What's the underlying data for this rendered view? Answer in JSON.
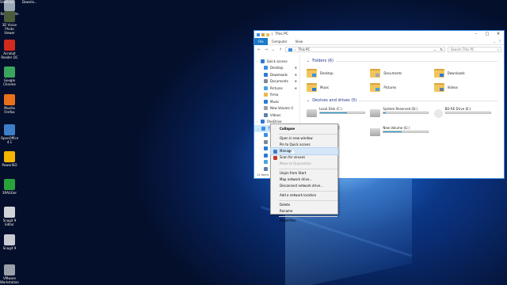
{
  "desktop": {
    "icons": [
      {
        "label": "Recycle Bin",
        "icon": "recycle-bin-icon",
        "color": "#9aa7b5"
      },
      {
        "label": "3D Vision Photo Viewer",
        "icon": "photo-viewer-icon",
        "color": "#4a5a3a"
      },
      {
        "label": "Acrobat Reader DC",
        "icon": "acrobat-icon",
        "color": "#d22a1e"
      },
      {
        "label": "Google Chrome",
        "icon": "chrome-icon",
        "color": "#3ba55d"
      },
      {
        "label": "Mozilla Firefox",
        "icon": "firefox-icon",
        "color": "#e8701a"
      },
      {
        "label": "OpenOffice 4.1",
        "icon": "openoffice-icon",
        "color": "#3d7ec7"
      },
      {
        "label": "PowerISO",
        "icon": "poweriso-icon",
        "color": "#f4b400"
      },
      {
        "label": "3RAGGer",
        "icon": "green-triangle-icon",
        "color": "#27a33a"
      },
      {
        "label": "Snagit 9 Editor",
        "icon": "snagit-editor-icon",
        "color": "#d0d4d8"
      },
      {
        "label": "Snagit 9",
        "icon": "snagit-icon",
        "color": "#c8ccd2"
      },
      {
        "label": "VMware Workstation",
        "icon": "vmware-icon",
        "color": "#9aa0a8"
      }
    ],
    "top_labels": [
      "Shortcut",
      "Downlo..."
    ]
  },
  "explorer": {
    "title": "This PC",
    "tabs": [
      "File",
      "Computer",
      "View"
    ],
    "address": "This PC",
    "search_placeholder": "Search This PC",
    "sidebar": [
      {
        "label": "Quick access",
        "icon": "star-icon",
        "color": "#2c7ad6",
        "level": 0
      },
      {
        "label": "Desktop",
        "icon": "desktop-icon",
        "color": "#3a8ee6",
        "level": 1,
        "pinned": true
      },
      {
        "label": "Downloads",
        "icon": "downloads-icon",
        "color": "#2c7ad6",
        "level": 1,
        "pinned": true
      },
      {
        "label": "Documents",
        "icon": "documents-icon",
        "color": "#7d8a99",
        "level": 1,
        "pinned": true
      },
      {
        "label": "Pictures",
        "icon": "pictures-icon",
        "color": "#4aa3df",
        "level": 1,
        "pinned": true
      },
      {
        "label": "firma",
        "icon": "folder-icon",
        "color": "#e8b84a",
        "level": 1
      },
      {
        "label": "Music",
        "icon": "music-icon",
        "color": "#2c7ad6",
        "level": 1
      },
      {
        "label": "New Volume (I",
        "icon": "drive-icon",
        "color": "#9aa0a8",
        "level": 1
      },
      {
        "label": "Videos",
        "icon": "videos-icon",
        "color": "#5d7fa8",
        "level": 1
      },
      {
        "label": "OneDrive",
        "icon": "onedrive-icon",
        "color": "#2c7ad6",
        "level": 0
      },
      {
        "label": "This PC",
        "icon": "pc-icon",
        "color": "#3a8ee6",
        "level": 0,
        "selected": true
      },
      {
        "label": "De",
        "icon": "desktop-icon",
        "color": "#3a8ee6",
        "level": 1
      },
      {
        "label": "Do",
        "icon": "documents-icon",
        "color": "#7d8a99",
        "level": 1
      },
      {
        "label": "Do",
        "icon": "downloads-icon",
        "color": "#2c7ad6",
        "level": 1
      },
      {
        "label": "M",
        "icon": "music-icon",
        "color": "#2c7ad6",
        "level": 1
      },
      {
        "label": "Pi",
        "icon": "pictures-icon",
        "color": "#4aa3df",
        "level": 1
      },
      {
        "label": "Vi",
        "icon": "videos-icon",
        "color": "#5d7fa8",
        "level": 1
      }
    ],
    "folders_header": "Folders (6)",
    "folders": [
      "Desktop",
      "Documents",
      "Downloads",
      "Music",
      "Pictures",
      "Videos"
    ],
    "drives_header": "Devices and drives (5)",
    "drives": [
      {
        "name": "Local Disk (C:)",
        "free": "",
        "fill": 0.6,
        "icon": "windows-drive-icon"
      },
      {
        "name": "System Reserved (D:)",
        "free": "",
        "fill": 0.05,
        "icon": "hdd-icon"
      },
      {
        "name": "BD-RE Drive (E:)",
        "free": "",
        "fill": 0,
        "icon": "bd-drive-icon"
      },
      {
        "name": "CD Drive (F:)",
        "free": "",
        "fill": 0,
        "icon": "cd-drive-icon"
      },
      {
        "name": "New Volume (G:)",
        "free": "",
        "fill": 0.4,
        "icon": "hdd-icon"
      }
    ],
    "status": "11 items"
  },
  "context_menu": {
    "items": [
      {
        "label": "Collapse",
        "bold": true
      },
      {
        "sep": true
      },
      {
        "label": "Open in new window"
      },
      {
        "label": "Pin to Quick access"
      },
      {
        "label": "Manage",
        "icon": "shield-icon",
        "highlight": true
      },
      {
        "label": "Scan for viruses",
        "icon": "antivirus-icon"
      },
      {
        "label": "Move to Quarantine",
        "disabled": true
      },
      {
        "sep": true
      },
      {
        "label": "Unpin from Start"
      },
      {
        "label": "Map network drive..."
      },
      {
        "label": "Disconnect network drive..."
      },
      {
        "sep": true
      },
      {
        "label": "Add a network location"
      },
      {
        "sep": true
      },
      {
        "label": "Delete"
      },
      {
        "label": "Rename"
      },
      {
        "sep": true
      },
      {
        "label": "Properties"
      }
    ]
  }
}
